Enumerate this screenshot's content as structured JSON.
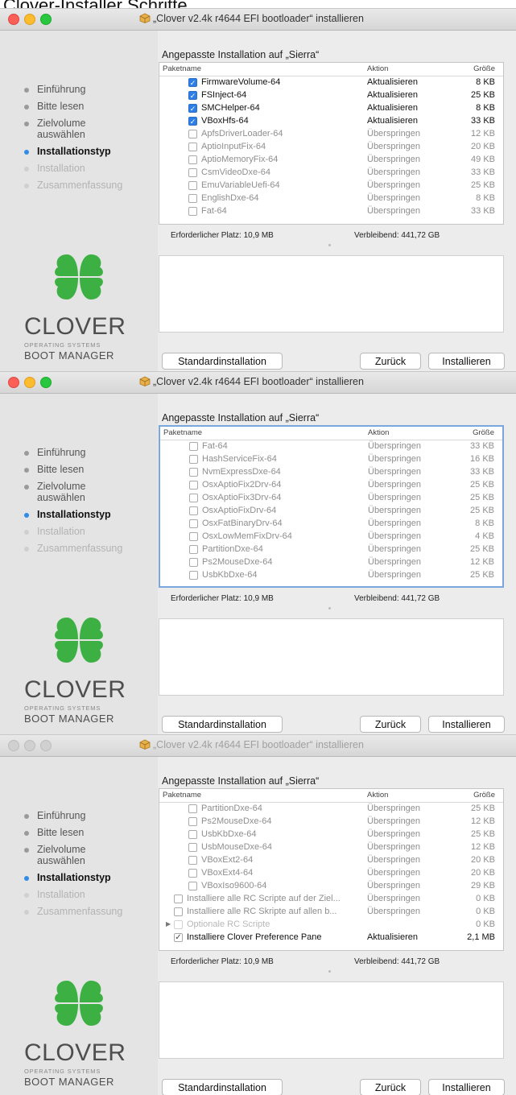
{
  "page_title": "Clover-Installer Schritte",
  "panels": [
    {
      "window_title": "„Clover v2.4k r4644 EFI bootloader“ installieren",
      "active": true,
      "table_focused": false,
      "rows": [
        {
          "indent": 1,
          "state": "on",
          "name": "FirmwareVolume-64",
          "action": "Aktualisieren",
          "size": "8 KB",
          "enabled": true
        },
        {
          "indent": 1,
          "state": "on",
          "name": "FSInject-64",
          "action": "Aktualisieren",
          "size": "25 KB",
          "enabled": true
        },
        {
          "indent": 1,
          "state": "on",
          "name": "SMCHelper-64",
          "action": "Aktualisieren",
          "size": "8 KB",
          "enabled": true
        },
        {
          "indent": 1,
          "state": "on",
          "name": "VBoxHfs-64",
          "action": "Aktualisieren",
          "size": "33 KB",
          "enabled": true
        },
        {
          "indent": 1,
          "state": "off",
          "name": "ApfsDriverLoader-64",
          "action": "Überspringen",
          "size": "12 KB",
          "enabled": false
        },
        {
          "indent": 1,
          "state": "off",
          "name": "AptioInputFix-64",
          "action": "Überspringen",
          "size": "20 KB",
          "enabled": false
        },
        {
          "indent": 1,
          "state": "off",
          "name": "AptioMemoryFix-64",
          "action": "Überspringen",
          "size": "49 KB",
          "enabled": false
        },
        {
          "indent": 1,
          "state": "off",
          "name": "CsmVideoDxe-64",
          "action": "Überspringen",
          "size": "33 KB",
          "enabled": false
        },
        {
          "indent": 1,
          "state": "off",
          "name": "EmuVariableUefi-64",
          "action": "Überspringen",
          "size": "25 KB",
          "enabled": false
        },
        {
          "indent": 1,
          "state": "off",
          "name": "EnglishDxe-64",
          "action": "Überspringen",
          "size": "8 KB",
          "enabled": false
        },
        {
          "indent": 1,
          "state": "off",
          "name": "Fat-64",
          "action": "Überspringen",
          "size": "33 KB",
          "enabled": false
        }
      ]
    },
    {
      "window_title": "„Clover v2.4k r4644 EFI bootloader“ installieren",
      "active": true,
      "table_focused": true,
      "rows": [
        {
          "indent": 1,
          "state": "off",
          "name": "Fat-64",
          "action": "Überspringen",
          "size": "33 KB",
          "enabled": false
        },
        {
          "indent": 1,
          "state": "off",
          "name": "HashServiceFix-64",
          "action": "Überspringen",
          "size": "16 KB",
          "enabled": false
        },
        {
          "indent": 1,
          "state": "off",
          "name": "NvmExpressDxe-64",
          "action": "Überspringen",
          "size": "33 KB",
          "enabled": false
        },
        {
          "indent": 1,
          "state": "off",
          "name": "OsxAptioFix2Drv-64",
          "action": "Überspringen",
          "size": "25 KB",
          "enabled": false
        },
        {
          "indent": 1,
          "state": "off",
          "name": "OsxAptioFix3Drv-64",
          "action": "Überspringen",
          "size": "25 KB",
          "enabled": false
        },
        {
          "indent": 1,
          "state": "off",
          "name": "OsxAptioFixDrv-64",
          "action": "Überspringen",
          "size": "25 KB",
          "enabled": false
        },
        {
          "indent": 1,
          "state": "off",
          "name": "OsxFatBinaryDrv-64",
          "action": "Überspringen",
          "size": "8 KB",
          "enabled": false
        },
        {
          "indent": 1,
          "state": "off",
          "name": "OsxLowMemFixDrv-64",
          "action": "Überspringen",
          "size": "4 KB",
          "enabled": false
        },
        {
          "indent": 1,
          "state": "off",
          "name": "PartitionDxe-64",
          "action": "Überspringen",
          "size": "25 KB",
          "enabled": false
        },
        {
          "indent": 1,
          "state": "off",
          "name": "Ps2MouseDxe-64",
          "action": "Überspringen",
          "size": "12 KB",
          "enabled": false
        },
        {
          "indent": 1,
          "state": "off",
          "name": "UsbKbDxe-64",
          "action": "Überspringen",
          "size": "25 KB",
          "enabled": false
        }
      ]
    },
    {
      "window_title": "„Clover v2.4k r4644 EFI bootloader“ installieren",
      "active": false,
      "table_focused": false,
      "rows": [
        {
          "indent": 1,
          "state": "off",
          "name": "PartitionDxe-64",
          "action": "Überspringen",
          "size": "25 KB",
          "enabled": false
        },
        {
          "indent": 1,
          "state": "off",
          "name": "Ps2MouseDxe-64",
          "action": "Überspringen",
          "size": "12 KB",
          "enabled": false
        },
        {
          "indent": 1,
          "state": "off",
          "name": "UsbKbDxe-64",
          "action": "Überspringen",
          "size": "25 KB",
          "enabled": false
        },
        {
          "indent": 1,
          "state": "off",
          "name": "UsbMouseDxe-64",
          "action": "Überspringen",
          "size": "12 KB",
          "enabled": false
        },
        {
          "indent": 1,
          "state": "off",
          "name": "VBoxExt2-64",
          "action": "Überspringen",
          "size": "20 KB",
          "enabled": false
        },
        {
          "indent": 1,
          "state": "off",
          "name": "VBoxExt4-64",
          "action": "Überspringen",
          "size": "20 KB",
          "enabled": false
        },
        {
          "indent": 1,
          "state": "off",
          "name": "VBoxIso9600-64",
          "action": "Überspringen",
          "size": "29 KB",
          "enabled": false
        },
        {
          "indent": 0,
          "state": "off",
          "name": "Installiere alle RC Scripte auf der Ziel...",
          "action": "Überspringen",
          "size": "0 KB",
          "enabled": false
        },
        {
          "indent": 0,
          "state": "off",
          "name": "Installiere alle RC Skripte auf allen b...",
          "action": "Überspringen",
          "size": "0 KB",
          "enabled": false
        },
        {
          "indent": 0,
          "state": "disabled",
          "name": "Optionale RC Scripte",
          "action": "",
          "size": "0 KB",
          "enabled": false,
          "disclosure": true
        },
        {
          "indent": 0,
          "state": "tick",
          "name": "Installiere Clover Preference Pane",
          "action": "Aktualisieren",
          "size": "2,1 MB",
          "enabled": true
        }
      ]
    }
  ],
  "sidebar": {
    "steps": [
      {
        "label": "Einführung",
        "state": "done"
      },
      {
        "label": "Bitte lesen",
        "state": "done"
      },
      {
        "label": "Zielvolume auswählen",
        "state": "done"
      },
      {
        "label": "Installationstyp",
        "state": "current"
      },
      {
        "label": "Installation",
        "state": "future"
      },
      {
        "label": "Zusammenfassung",
        "state": "future"
      }
    ],
    "logo_name": "CLOVER",
    "logo_sub": "OPERATING SYSTEMS",
    "logo_manager": "BOOT MANAGER"
  },
  "main": {
    "heading": "Angepasste Installation auf „Sierra“",
    "col_name": "Paketname",
    "col_action": "Aktion",
    "col_size": "Größe",
    "required": "Erforderlicher Platz:  10,9 MB",
    "remaining": "Verbleibend:  441,72 GB"
  },
  "buttons": {
    "standard": "Standardinstallation",
    "back": "Zurück",
    "install": "Installieren"
  },
  "colors": {
    "accent": "#2f7ee6",
    "close": "#fc5f57",
    "minimize": "#fdbb2e",
    "zoom": "#29c73f",
    "clover_green": "#3cb043"
  }
}
